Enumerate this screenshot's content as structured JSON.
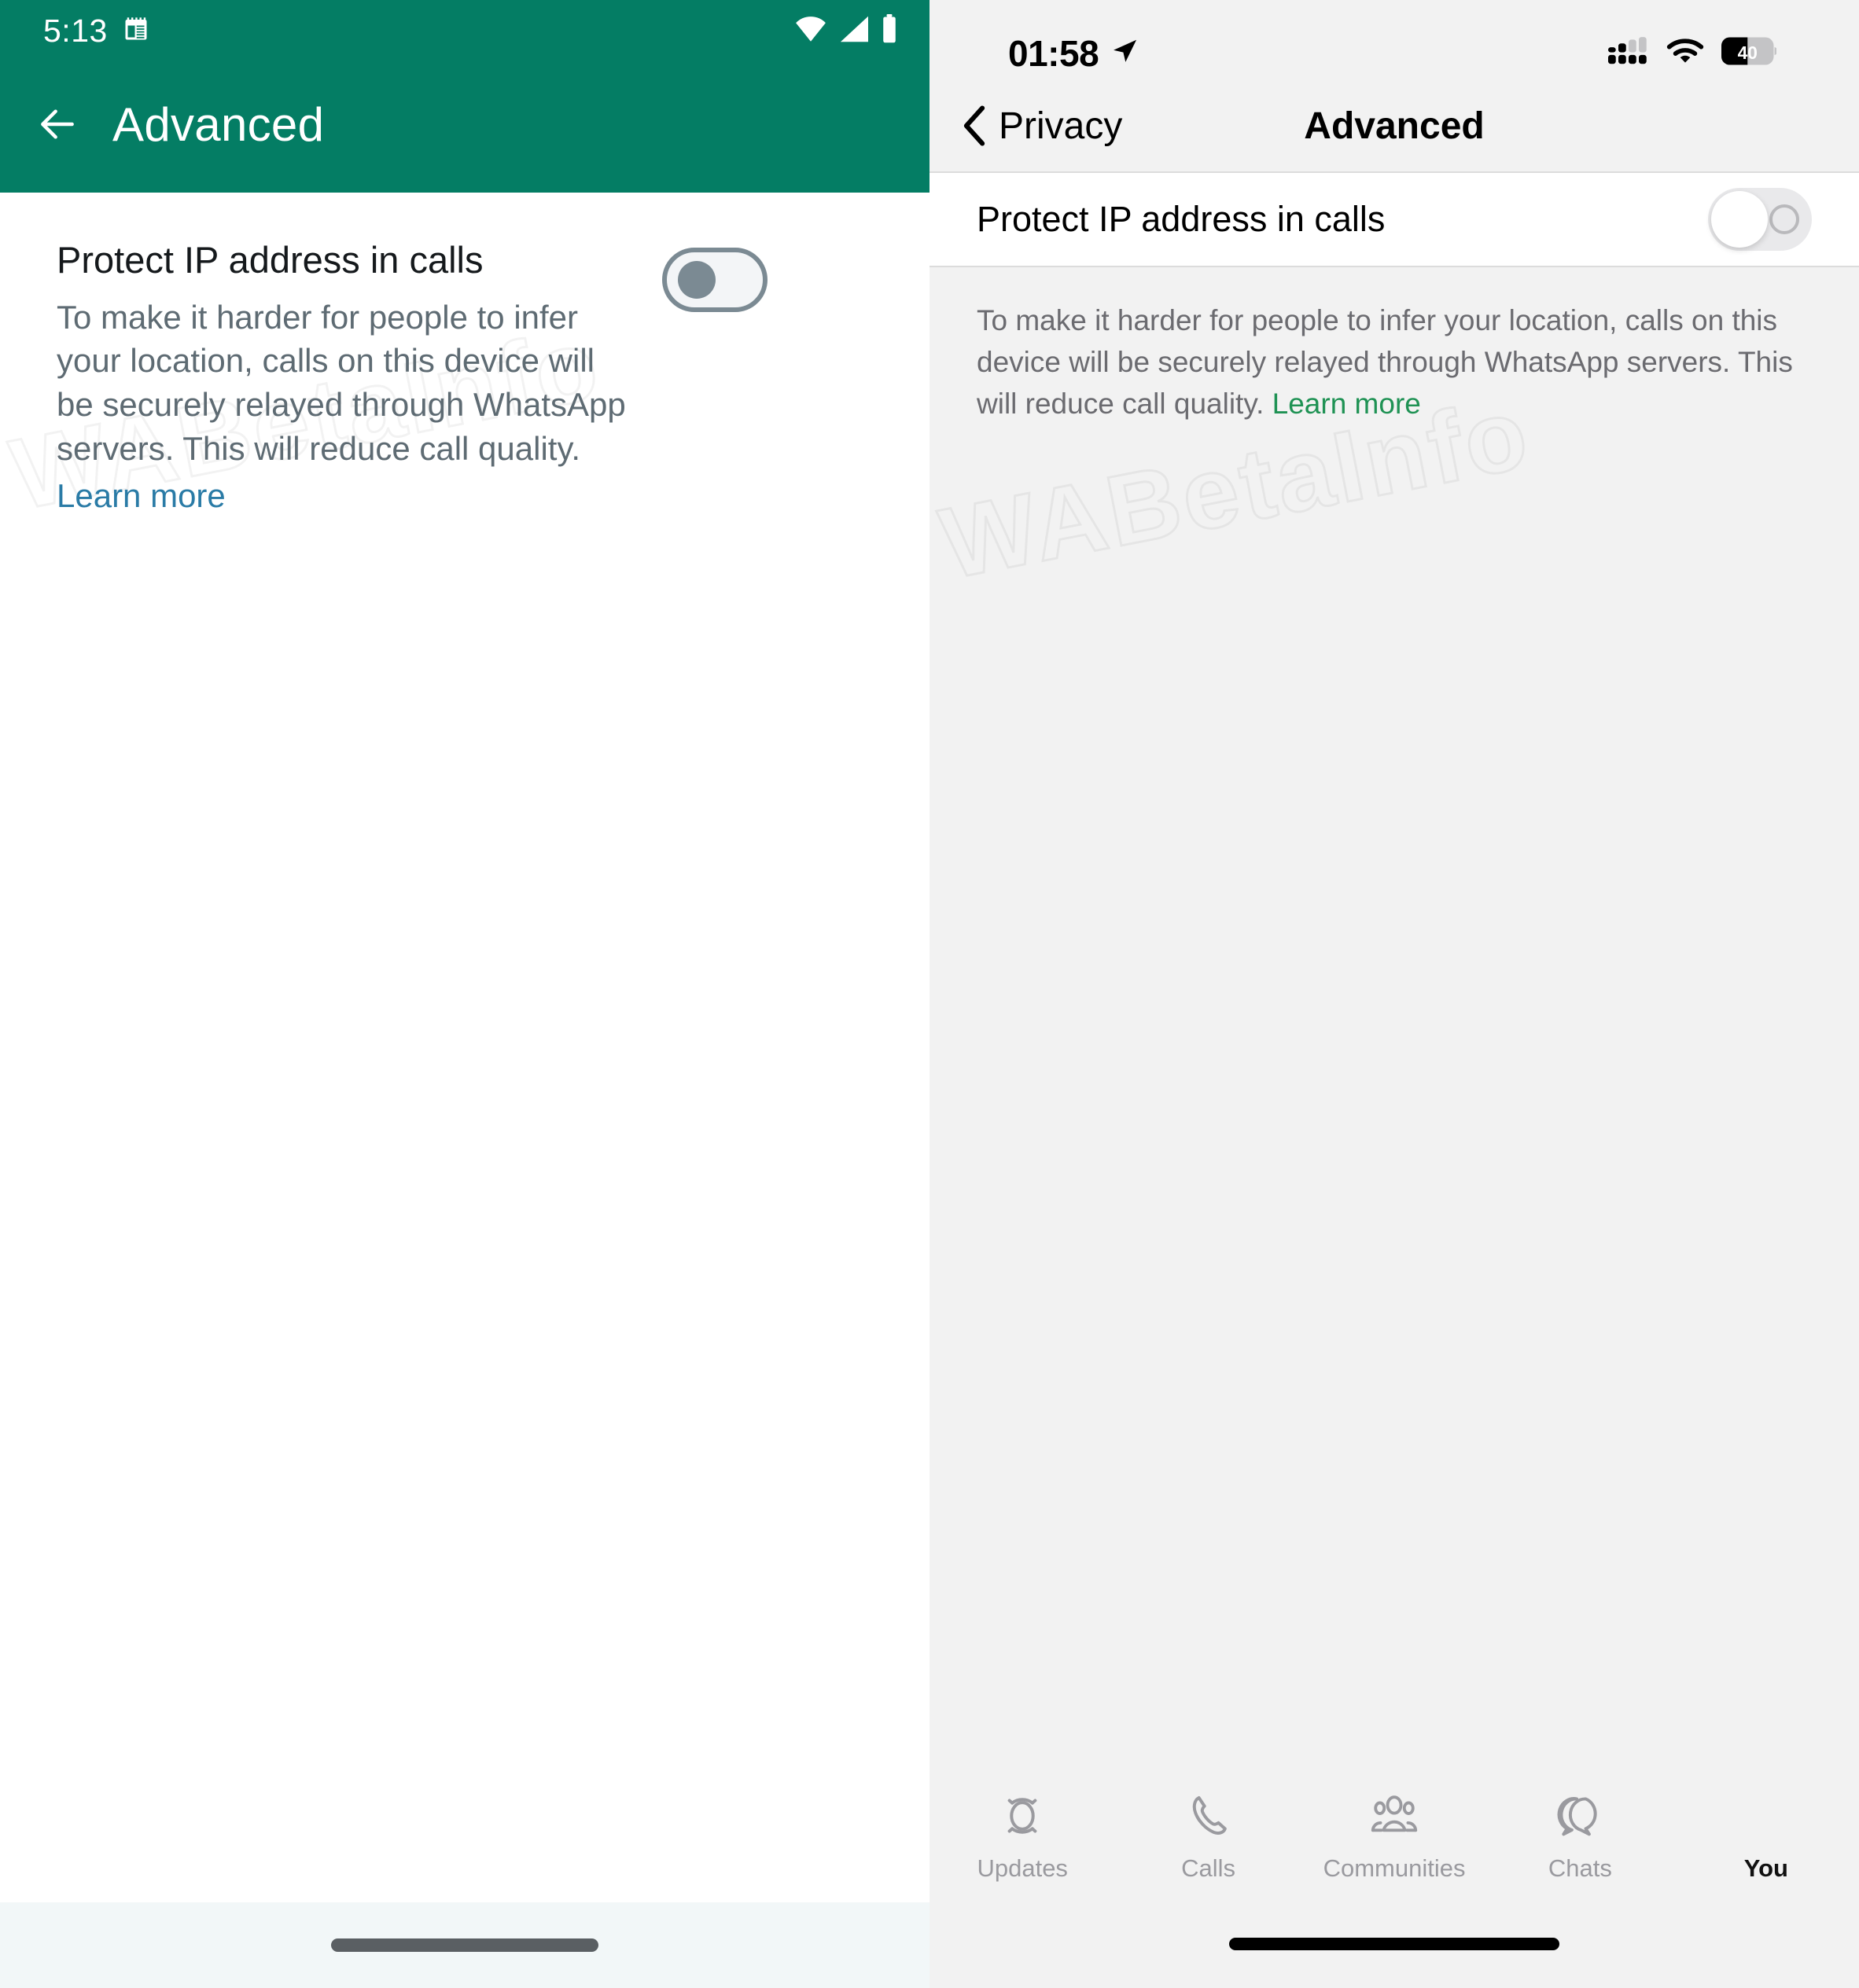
{
  "watermark": {
    "text": "WABetaInfo"
  },
  "colors": {
    "android_header_green": "#047d64",
    "android_link_blue": "#2a7ba6",
    "ios_link_green": "#1f9254",
    "ios_background": "#f2f2f2"
  },
  "android": {
    "status_bar": {
      "clock": "5:13",
      "notification_icon": "calendar-note-icon",
      "icons": [
        "wifi-icon",
        "cellular-signal-icon",
        "battery-icon"
      ]
    },
    "app_bar": {
      "back_icon": "arrow-left-icon",
      "title": "Advanced"
    },
    "setting": {
      "title": "Protect IP address in calls",
      "description": "To make it harder for people to infer your location, calls on this device will be securely relayed through WhatsApp servers. This will reduce call quality.",
      "learn_more": "Learn more",
      "toggle_state": "off"
    },
    "nav_bar": {
      "gesture_pill": "home-gesture-pill"
    }
  },
  "ios": {
    "status_bar": {
      "clock": "01:58",
      "location_icon": "location-arrow-icon",
      "icons": [
        "cellular-signal-icon",
        "wifi-icon",
        "battery-icon"
      ],
      "battery_level": "40"
    },
    "nav_bar": {
      "back_icon": "chevron-left-icon",
      "back_label": "Privacy",
      "title": "Advanced"
    },
    "setting": {
      "label": "Protect IP address in calls",
      "toggle_state": "off"
    },
    "footnote": {
      "text": "To make it harder for people to infer your location, calls on this device will be securely relayed through WhatsApp servers. This will reduce call quality. ",
      "learn_more": "Learn more"
    },
    "tab_bar": {
      "tabs": [
        {
          "label": "Updates",
          "icon": "updates-ring-icon",
          "active": false
        },
        {
          "label": "Calls",
          "icon": "phone-icon",
          "active": false
        },
        {
          "label": "Communities",
          "icon": "communities-people-icon",
          "active": false
        },
        {
          "label": "Chats",
          "icon": "chat-bubbles-icon",
          "active": false
        },
        {
          "label": "You",
          "icon": "avatar-icon",
          "active": true
        }
      ]
    },
    "home_bar": {
      "home_indicator": "home-indicator"
    }
  }
}
